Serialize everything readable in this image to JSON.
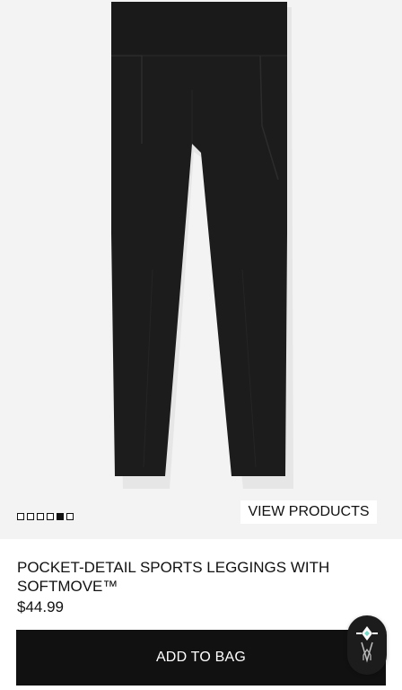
{
  "product": {
    "image_icon": "leggings-product-image",
    "carousel": {
      "total": 6,
      "active_index": 4
    },
    "view_products_label": "VIEW PRODUCTS",
    "title": "POCKET-DETAIL SPORTS LEGGINGS WITH SOFTMOVE™",
    "price": "$44.99"
  },
  "actions": {
    "add_to_bag_label": "ADD TO BAG",
    "assistant_icon": "assistant-logo-icon"
  },
  "colors": {
    "hero_bg": "#f3f3f3",
    "leggings": "#1b1b1b",
    "button_bg": "#111111",
    "button_text": "#ffffff"
  }
}
